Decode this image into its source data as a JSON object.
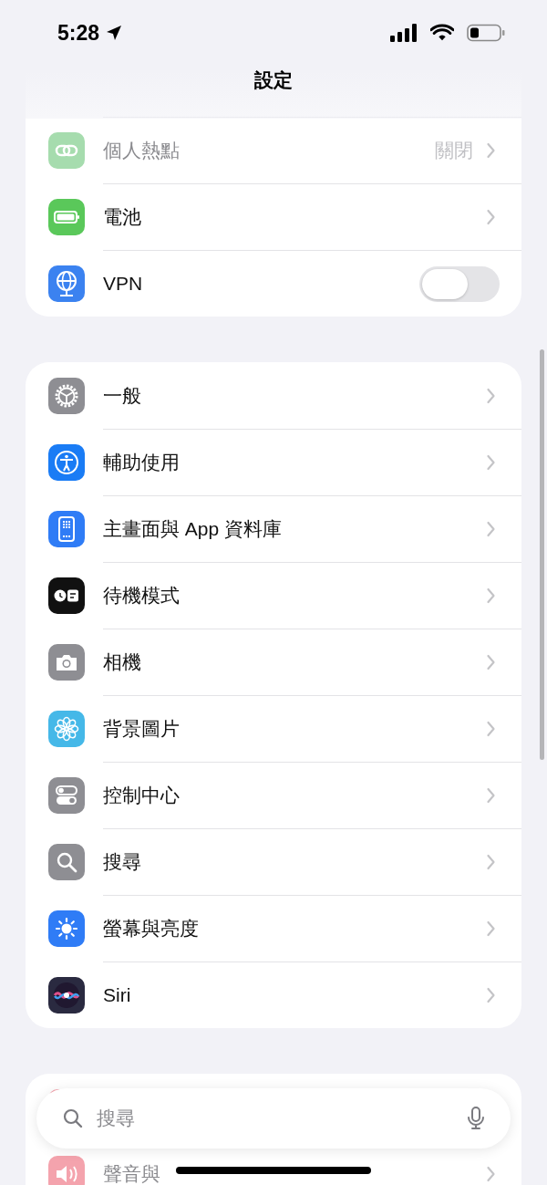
{
  "status_bar": {
    "time": "5:28"
  },
  "navigation": {
    "title": "設定"
  },
  "sections": [
    {
      "rows": [
        {
          "label": "個人熱點",
          "value": "關閉",
          "kind": "link",
          "disabled": true,
          "color": "#a6dcae"
        },
        {
          "label": "電池",
          "kind": "link",
          "disabled": false,
          "color": "#5ac85a"
        },
        {
          "label": "VPN",
          "kind": "toggle",
          "on": false,
          "disabled": false,
          "color": "#3b82f0"
        }
      ]
    },
    {
      "rows": [
        {
          "label": "一般",
          "kind": "link",
          "disabled": false,
          "color": "#8e8e93"
        },
        {
          "label": "輔助使用",
          "kind": "link",
          "disabled": false,
          "color": "#1a7cf5"
        },
        {
          "label": "主畫面與 App 資料庫",
          "kind": "link",
          "disabled": false,
          "color": "#2f7cf6"
        },
        {
          "label": "待機模式",
          "kind": "link",
          "disabled": false,
          "color": "#111111"
        },
        {
          "label": "相機",
          "kind": "link",
          "disabled": false,
          "color": "#8e8e93"
        },
        {
          "label": "背景圖片",
          "kind": "link",
          "disabled": false,
          "color": "#45b8e8"
        },
        {
          "label": "控制中心",
          "kind": "link",
          "disabled": false,
          "color": "#8e8e93"
        },
        {
          "label": "搜尋",
          "kind": "link",
          "disabled": false,
          "color": "#8e8e93"
        },
        {
          "label": "螢幕與亮度",
          "kind": "link",
          "disabled": false,
          "color": "#2f7cf6"
        },
        {
          "label": "Siri",
          "kind": "link",
          "disabled": false,
          "color": "#2a2a40"
        }
      ]
    },
    {
      "rows": [
        {
          "label": "聲音與",
          "kind": "link",
          "disabled": true,
          "color": "#f4a3ad"
        }
      ]
    }
  ],
  "search": {
    "placeholder": "搜尋"
  }
}
